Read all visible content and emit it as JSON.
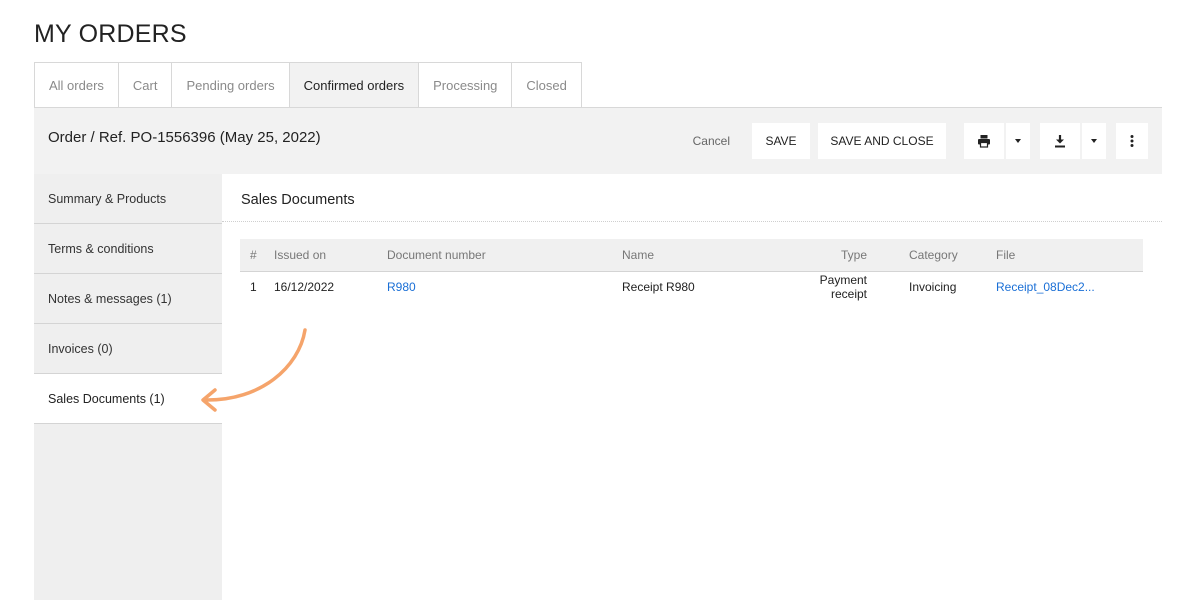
{
  "page": {
    "title": "MY ORDERS"
  },
  "tabs": [
    {
      "label": "All orders"
    },
    {
      "label": "Cart"
    },
    {
      "label": "Pending orders"
    },
    {
      "label": "Confirmed orders",
      "active": true
    },
    {
      "label": "Processing"
    },
    {
      "label": "Closed"
    }
  ],
  "order": {
    "title": "Order / Ref. PO-1556396 (May 25, 2022)",
    "toolbar": {
      "cancel_label": "Cancel",
      "save_label": "SAVE",
      "save_close_label": "SAVE AND CLOSE",
      "print_icon": "print-icon",
      "download_icon": "download-icon",
      "more_icon": "more-vertical-icon"
    }
  },
  "sidebar": {
    "items": [
      {
        "label": "Summary & Products"
      },
      {
        "label": "Terms & conditions"
      },
      {
        "label": "Notes & messages (1)"
      },
      {
        "label": "Invoices (0)"
      },
      {
        "label": "Sales Documents (1)",
        "active": true
      }
    ]
  },
  "sales_documents": {
    "title": "Sales Documents",
    "columns": [
      "#",
      "Issued on",
      "Document number",
      "Name",
      "Type",
      "Category",
      "File"
    ],
    "rows": [
      {
        "num": "1",
        "issued_on": "16/12/2022",
        "document_number": "R980",
        "name": "Receipt R980",
        "type": "Payment receipt",
        "category": "Invoicing",
        "file": "Receipt_08Dec2..."
      }
    ]
  },
  "colors": {
    "link": "#1a6fd6",
    "panel_bg": "#f2f2f2",
    "annotation_arrow": "#f5a46b"
  }
}
